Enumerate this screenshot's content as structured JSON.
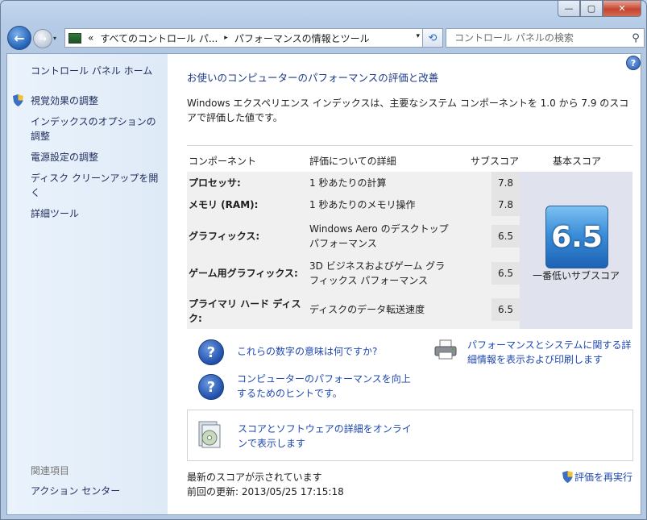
{
  "window": {
    "controls": {
      "minimize": "—",
      "maximize": "▢",
      "close": "✕"
    }
  },
  "navbar": {
    "back_icon": "←",
    "forward_icon": "→",
    "history_dropdown_icon": "▾",
    "overflow": "«",
    "breadcrumbs": [
      "すべてのコントロール パ...",
      "パフォーマンスの情報とツール"
    ],
    "breadcrumb_separator": "▸",
    "address_dropdown_icon": "▾",
    "refresh_icon": "⟲",
    "search_placeholder": "コントロール パネルの検索",
    "search_icon": "⚲"
  },
  "sidebar": {
    "home": "コントロール パネル ホーム",
    "items": [
      "視覚効果の調整",
      "インデックスのオプションの調整",
      "電源設定の調整",
      "ディスク クリーンアップを開く",
      "詳細ツール"
    ],
    "related_header": "関連項目",
    "related_items": [
      "アクション センター"
    ]
  },
  "main": {
    "help_icon": "?",
    "heading": "お使いのコンピューターのパフォーマンスの評価と改善",
    "description": "Windows エクスペリエンス インデックスは、主要なシステム コンポーネントを 1.0 から 7.9 のスコアで評価した値です。",
    "table": {
      "headers": {
        "component": "コンポーネント",
        "detail": "評価についての詳細",
        "subscore": "サブスコア",
        "base": "基本スコア"
      },
      "rows": [
        {
          "component": "プロセッサ:",
          "detail": "1 秒あたりの計算",
          "subscore": "7.8"
        },
        {
          "component": "メモリ (RAM):",
          "detail": "1 秒あたりのメモリ操作",
          "subscore": "7.8"
        },
        {
          "component": "グラフィックス:",
          "detail": "Windows Aero のデスクトップ パフォーマンス",
          "subscore": "6.5"
        },
        {
          "component": "ゲーム用グラフィックス:",
          "detail": "3D ビジネスおよびゲーム グラフィックス パフォーマンス",
          "subscore": "6.5"
        },
        {
          "component": "プライマリ ハード ディスク:",
          "detail": "ディスクのデータ転送速度",
          "subscore": "6.5"
        }
      ],
      "base_score": "6.5",
      "base_score_label": "一番低いサブスコア"
    },
    "links": {
      "numbers_meaning": "これらの数字の意味は何ですか?",
      "tips": "コンピューターのパフォーマンスを向上するためのヒントです。",
      "print_details": "パフォーマンスとシステムに関する詳細情報を表示および印刷します",
      "online": "スコアとソフトウェアの詳細をオンラインで表示します"
    },
    "status": {
      "current": "最新のスコアが示されています",
      "last_update_label": "前回の更新:",
      "last_update": "2013/05/25 17:15:18",
      "rerun": "評価を再実行"
    }
  },
  "colors": {
    "link": "#1e48b0",
    "heading": "#1c3a87",
    "badge": "#3b8fd9",
    "sidebar_bg": "#e4eef9"
  }
}
